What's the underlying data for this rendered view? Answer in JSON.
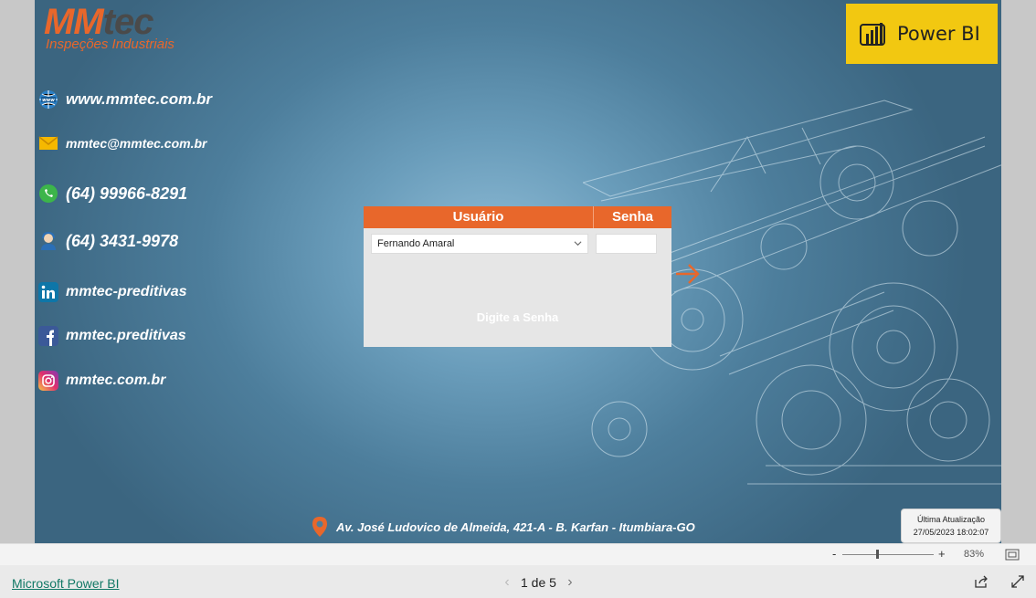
{
  "logo": {
    "brand_mm": "MM",
    "brand_tec": "tec",
    "tagline": "Inspeções Industriais"
  },
  "contacts": [
    {
      "icon": "globe-icon",
      "text": "www.mmtec.com.br"
    },
    {
      "icon": "envelope-icon",
      "text": "mmtec@mmtec.com.br"
    },
    {
      "icon": "whatsapp-icon",
      "text": "(64) 99966-8291"
    },
    {
      "icon": "phone-agent-icon",
      "text": "(64) 3431-9978"
    },
    {
      "icon": "linkedin-icon",
      "text": "mmtec-preditivas"
    },
    {
      "icon": "facebook-icon",
      "text": "mmtec.preditivas"
    },
    {
      "icon": "instagram-icon",
      "text": "mmtec.com.br"
    }
  ],
  "powerbi_badge": {
    "label": "Power BI"
  },
  "login": {
    "user_header": "Usuário",
    "password_header": "Senha",
    "selected_user": "Fernando Amaral",
    "password_value": "",
    "hint": "Digite a Senha"
  },
  "address": "Av. José Ludovico de Almeida, 421-A - B. Karfan - Itumbiara-GO",
  "last_update": {
    "label": "Última Atualização",
    "value": "27/05/2023 18:02:07"
  },
  "zoom": {
    "minus": "-",
    "plus": "+",
    "percent": "83%",
    "level": 0.38
  },
  "footer": {
    "brand": "Microsoft Power BI",
    "page_indicator": "1 de 5",
    "prev": "‹",
    "next": "›"
  },
  "colors": {
    "accent": "#e8672b",
    "powerbi_yellow": "#f2c811",
    "background": "#4d7e9c"
  }
}
